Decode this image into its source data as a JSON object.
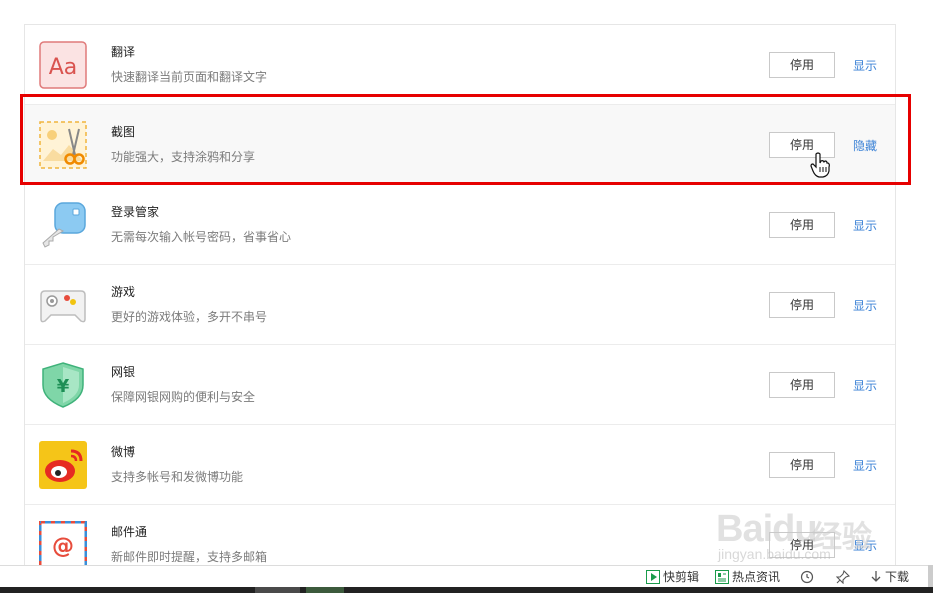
{
  "extensions": [
    {
      "name": "翻译",
      "desc": "快速翻译当前页面和翻译文字",
      "button": "停用",
      "toggle": "显示"
    },
    {
      "name": "截图",
      "desc": "功能强大，支持涂鸦和分享",
      "button": "停用",
      "toggle": "隐藏"
    },
    {
      "name": "登录管家",
      "desc": "无需每次输入帐号密码，省事省心",
      "button": "停用",
      "toggle": "显示"
    },
    {
      "name": "游戏",
      "desc": "更好的游戏体验，多开不串号",
      "button": "停用",
      "toggle": "显示"
    },
    {
      "name": "网银",
      "desc": "保障网银网购的便利与安全",
      "button": "停用",
      "toggle": "显示"
    },
    {
      "name": "微博",
      "desc": "支持多帐号和发微博功能",
      "button": "停用",
      "toggle": "显示"
    },
    {
      "name": "邮件通",
      "desc": "新邮件即时提醒，支持多邮箱",
      "button": "停用",
      "toggle": "显示"
    }
  ],
  "icons": [
    "translate-icon",
    "screenshot-icon",
    "key-icon",
    "gamepad-icon",
    "shield-icon",
    "weibo-icon",
    "mail-icon"
  ],
  "colors": {
    "link": "#3b82d6",
    "highlight_border": "#e60000"
  },
  "watermark": {
    "brand": "Baidu",
    "sub": "经验",
    "url": "jingyan.baidu.com"
  },
  "statusbar": {
    "quick_cut": "快剪辑",
    "hot_news": "热点资讯",
    "download": "下载"
  }
}
